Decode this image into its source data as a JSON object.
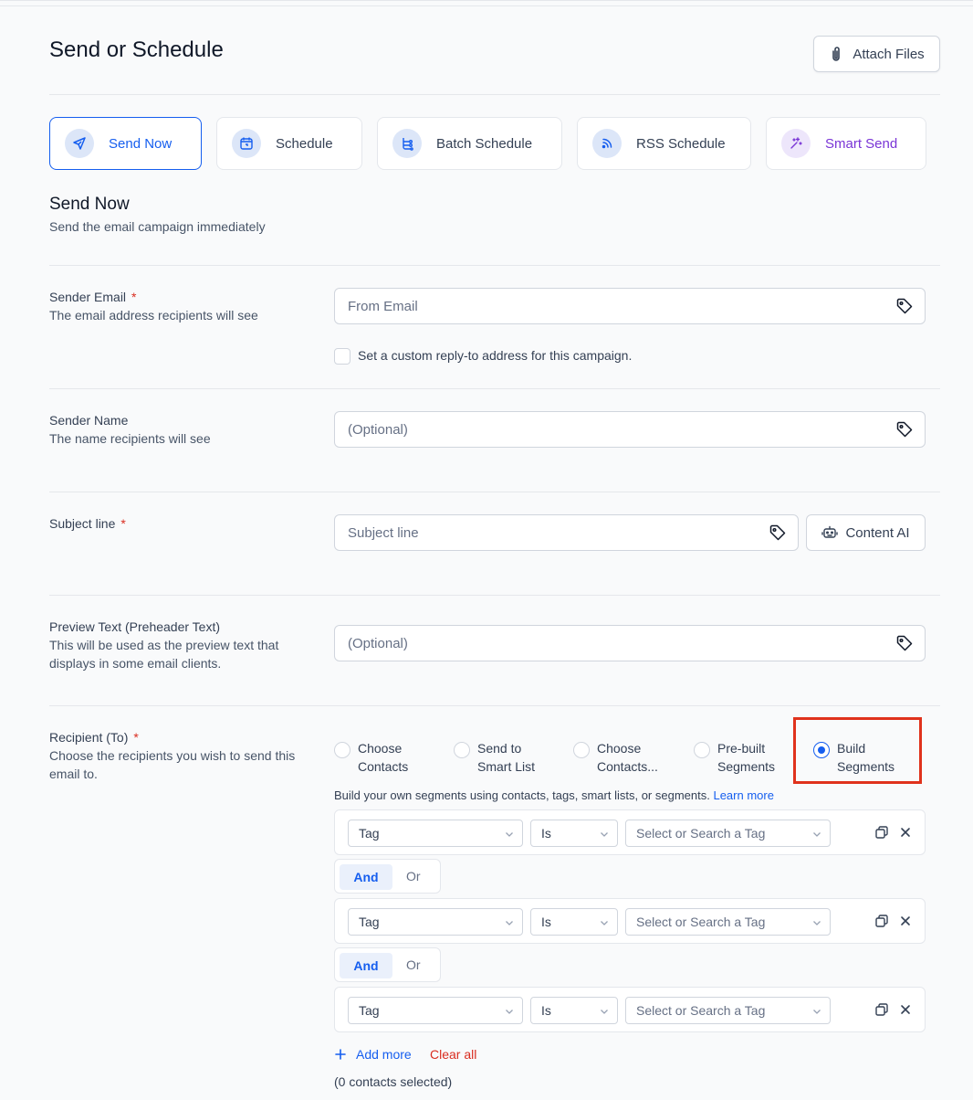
{
  "header": {
    "title": "Send or Schedule",
    "attach_label": "Attach Files"
  },
  "tabs": [
    {
      "label": "Send Now",
      "icon": "send-icon"
    },
    {
      "label": "Schedule",
      "icon": "calendar-icon"
    },
    {
      "label": "Batch Schedule",
      "icon": "batch-icon"
    },
    {
      "label": "RSS Schedule",
      "icon": "rss-icon"
    },
    {
      "label": "Smart Send",
      "icon": "sparkle-icon"
    }
  ],
  "section": {
    "title": "Send Now",
    "subtitle": "Send the email campaign immediately"
  },
  "sender_email": {
    "label": "Sender Email",
    "required": "*",
    "description": "The email address recipients will see",
    "placeholder": "From Email",
    "reply_to_label": "Set a custom reply-to address for this campaign."
  },
  "sender_name": {
    "label": "Sender Name",
    "description": "The name recipients will see",
    "placeholder": "(Optional)"
  },
  "subject": {
    "label": "Subject line",
    "required": "*",
    "placeholder": "Subject line",
    "ai_label": "Content AI"
  },
  "preview_text": {
    "label": "Preview Text (Preheader Text)",
    "description": "This will be used as the preview text that displays in some email clients.",
    "placeholder": "(Optional)"
  },
  "recipient": {
    "label": "Recipient (To)",
    "required": "*",
    "description": "Choose the recipients you wish to send this email to.",
    "options": [
      {
        "line1": "Choose",
        "line2": "Contacts"
      },
      {
        "line1": "Send to",
        "line2": "Smart List"
      },
      {
        "line1": "Choose",
        "line2": "Contacts..."
      },
      {
        "line1": "Pre-built",
        "line2": "Segments"
      },
      {
        "line1": "Build",
        "line2": "Segments"
      }
    ],
    "selected_option": "Build Segments",
    "help_text": "Build your own segments using contacts, tags, smart lists, or segments.",
    "learn_more": "Learn more",
    "segments": [
      {
        "field": "Tag",
        "operator": "Is",
        "value": "Select or Search a Tag"
      },
      {
        "field": "Tag",
        "operator": "Is",
        "value": "Select or Search a Tag"
      },
      {
        "field": "Tag",
        "operator": "Is",
        "value": "Select or Search a Tag"
      }
    ],
    "and_label": "And",
    "or_label": "Or",
    "add_more": "Add more",
    "clear_all": "Clear all",
    "contacts_selected": "(0 contacts selected)"
  },
  "colors": {
    "accent": "#155eef",
    "danger": "#d92d20",
    "highlight": "#e0321c",
    "smart": "#7a35d6"
  }
}
